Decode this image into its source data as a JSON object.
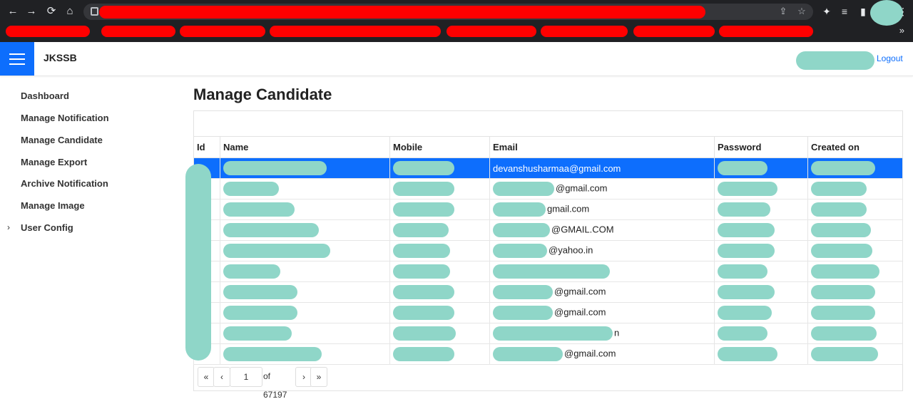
{
  "browser": {
    "back_icon": "←",
    "forward_icon": "→",
    "reload_icon": "⟳",
    "home_icon": "⌂",
    "share_icon": "⇪",
    "star_icon": "☆",
    "extensions_icon": "✦",
    "reading_list_icon": "≡",
    "sidepanel_icon": "▮",
    "menu_icon": "⋮",
    "bookmarks_more": "»"
  },
  "header": {
    "brand": "JKSSB",
    "logout": "Logout"
  },
  "sidebar": {
    "items": [
      {
        "label": "Dashboard"
      },
      {
        "label": "Manage Notification"
      },
      {
        "label": "Manage Candidate"
      },
      {
        "label": "Manage Export"
      },
      {
        "label": "Archive Notification"
      },
      {
        "label": "Manage Image"
      },
      {
        "label": "User Config",
        "expandable": true
      }
    ]
  },
  "main": {
    "title": "Manage Candidate",
    "columns": [
      "Id",
      "Name",
      "Mobile",
      "Email",
      "Password",
      "Created on"
    ],
    "rows": [
      {
        "email": "devanshusharmaa@gmail.com",
        "selected": true
      },
      {
        "email": "@gmail.com"
      },
      {
        "email": "gmail.com"
      },
      {
        "email": "@GMAIL.COM"
      },
      {
        "email": "@yahoo.in"
      },
      {
        "email": ""
      },
      {
        "email": "@gmail.com"
      },
      {
        "email": "@gmail.com"
      },
      {
        "email": "n"
      },
      {
        "email": "@gmail.com"
      }
    ]
  },
  "pager": {
    "first_icon": "«",
    "prev_icon": "‹",
    "current_page": "1",
    "of_text": "of 67197",
    "next_icon": "›",
    "last_icon": "»"
  },
  "colors": {
    "accent": "#0d6efd",
    "redaction_red": "#ff0000",
    "redaction_teal": "#8fd6c8"
  }
}
